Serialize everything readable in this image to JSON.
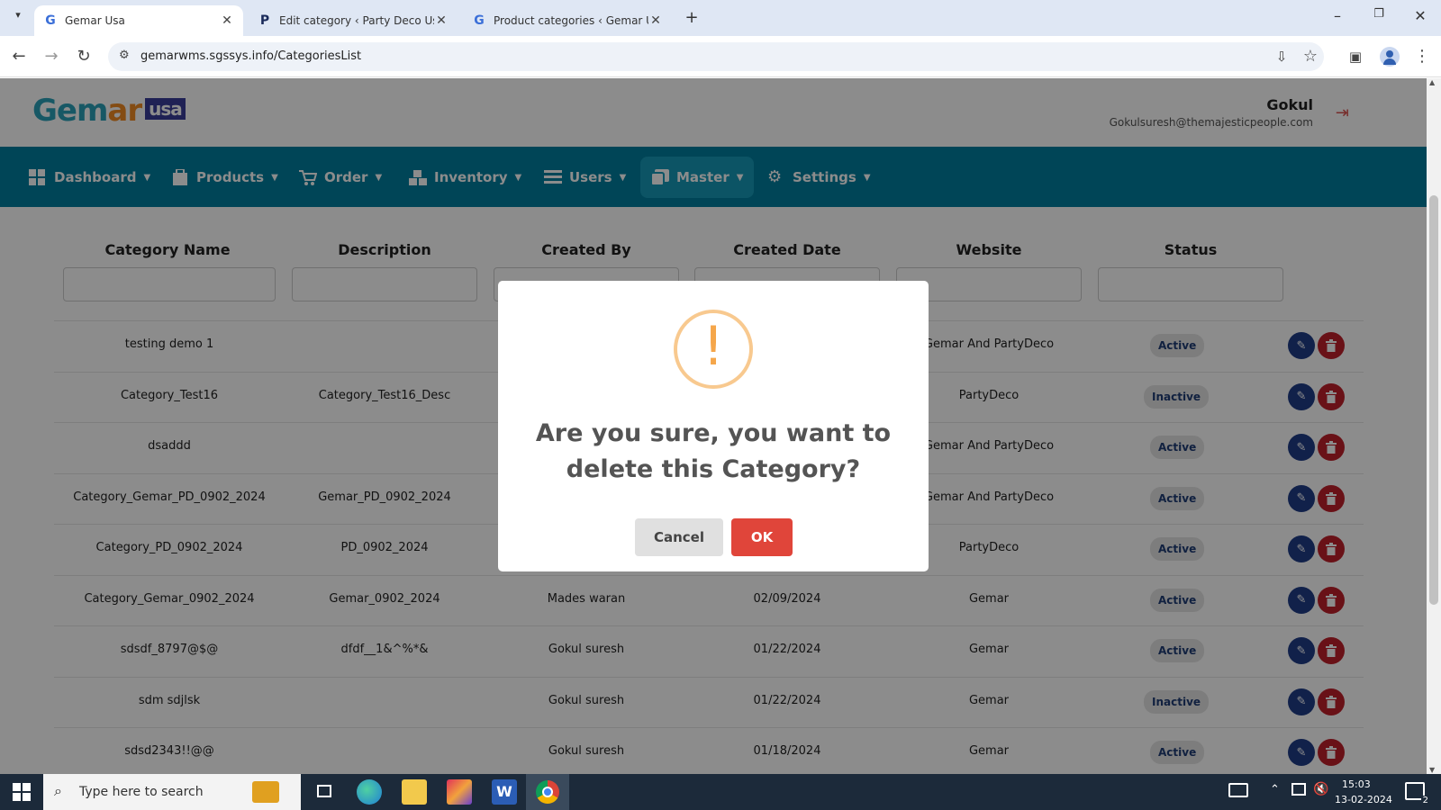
{
  "browser": {
    "tabs": [
      {
        "title": "Gemar Usa",
        "favicon": "G"
      },
      {
        "title": "Edit category ‹ Party Deco Usa –",
        "favicon": "P"
      },
      {
        "title": "Product categories ‹ Gemar Usa",
        "favicon": "G"
      }
    ],
    "url": "gemarwms.sgssys.info/CategoriesList"
  },
  "header": {
    "logo_main_1": "Gem",
    "logo_main_2": "ar",
    "logo_badge": "usa",
    "user_name": "Gokul",
    "user_email": "Gokulsuresh@themajesticpeople.com"
  },
  "nav": {
    "items": [
      {
        "label": "Dashboard"
      },
      {
        "label": "Products"
      },
      {
        "label": "Order"
      },
      {
        "label": "Inventory"
      },
      {
        "label": "Users"
      },
      {
        "label": "Master"
      },
      {
        "label": "Settings"
      }
    ]
  },
  "table": {
    "columns": [
      "Category Name",
      "Description",
      "Created By",
      "Created Date",
      "Website",
      "Status"
    ],
    "rows": [
      {
        "name": "testing demo 1",
        "desc": "",
        "by": "",
        "date": "",
        "site": "Gemar And PartyDeco",
        "status": "Active"
      },
      {
        "name": "Category_Test16",
        "desc": "Category_Test16_Desc",
        "by": "",
        "date": "",
        "site": "PartyDeco",
        "status": "Inactive"
      },
      {
        "name": "dsaddd",
        "desc": "",
        "by": "",
        "date": "",
        "site": "Gemar And PartyDeco",
        "status": "Active"
      },
      {
        "name": "Category_Gemar_PD_0902_2024",
        "desc": "Gemar_PD_0902_2024",
        "by": "",
        "date": "",
        "site": "Gemar And PartyDeco",
        "status": "Active"
      },
      {
        "name": "Category_PD_0902_2024",
        "desc": "PD_0902_2024",
        "by": "",
        "date": "",
        "site": "PartyDeco",
        "status": "Active"
      },
      {
        "name": "Category_Gemar_0902_2024",
        "desc": "Gemar_0902_2024",
        "by": "Mades waran",
        "date": "02/09/2024",
        "site": "Gemar",
        "status": "Active"
      },
      {
        "name": "sdsdf_8797@$@",
        "desc": "dfdf__1&^%*&",
        "by": "Gokul suresh",
        "date": "01/22/2024",
        "site": "Gemar",
        "status": "Active"
      },
      {
        "name": "sdm sdjlsk",
        "desc": "",
        "by": "Gokul suresh",
        "date": "01/22/2024",
        "site": "Gemar",
        "status": "Inactive"
      },
      {
        "name": "sdsd2343!!@@",
        "desc": "",
        "by": "Gokul suresh",
        "date": "01/18/2024",
        "site": "Gemar",
        "status": "Active"
      }
    ]
  },
  "dialog": {
    "title": "Are you sure, you want to delete this Category?",
    "icon_symbol": "!",
    "cancel_label": "Cancel",
    "ok_label": "OK"
  },
  "taskbar": {
    "search_placeholder": "Type here to search",
    "time": "15:03",
    "date": "13-02-2024",
    "notification_count": "2"
  },
  "colors": {
    "nav_bg": "#007e9e",
    "ok_button": "#e0453a",
    "edit_button": "#1f3c88",
    "delete_button": "#c0202a"
  }
}
